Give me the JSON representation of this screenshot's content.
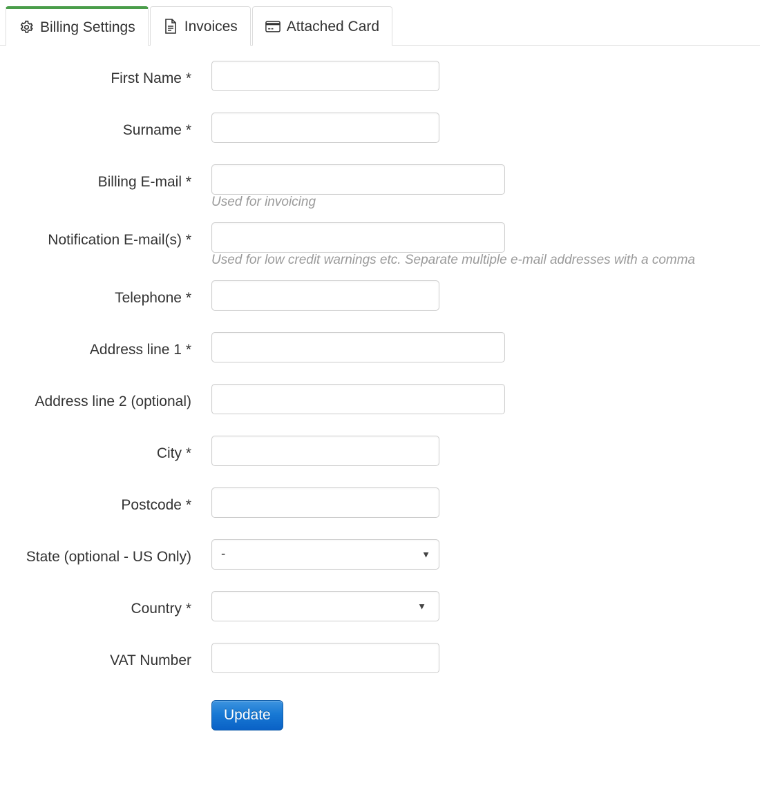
{
  "tabs": [
    {
      "label": "Billing Settings",
      "icon": "gear-icon",
      "active": true
    },
    {
      "label": "Invoices",
      "icon": "document-icon",
      "active": false
    },
    {
      "label": "Attached Card",
      "icon": "credit-card-icon",
      "active": false
    }
  ],
  "form": {
    "fields": [
      {
        "label": "First Name *",
        "type": "text",
        "value": "",
        "placeholder": "",
        "width": "short"
      },
      {
        "label": "Surname *",
        "type": "text",
        "value": "",
        "placeholder": "",
        "width": "short"
      },
      {
        "label": "Billing E-mail *",
        "type": "text",
        "value": "",
        "placeholder": "",
        "width": "wide",
        "help": "Used for invoicing"
      },
      {
        "label": "Notification E-mail(s) *",
        "type": "text",
        "value": "",
        "placeholder": "",
        "width": "wide",
        "help": "Used for low credit warnings etc. Separate multiple e-mail addresses with a comma"
      },
      {
        "label": "Telephone *",
        "type": "text",
        "value": "",
        "placeholder": "",
        "width": "short"
      },
      {
        "label": "Address line 1 *",
        "type": "text",
        "value": "",
        "placeholder": "",
        "width": "wide"
      },
      {
        "label": "Address line 2 (optional)",
        "type": "text",
        "value": "",
        "placeholder": "",
        "width": "wide"
      },
      {
        "label": "City *",
        "type": "text",
        "value": "",
        "placeholder": "",
        "width": "short"
      },
      {
        "label": "Postcode *",
        "type": "text",
        "value": "",
        "placeholder": "",
        "width": "short"
      },
      {
        "label": "State (optional - US Only)",
        "type": "select",
        "value": "-",
        "width": "short"
      },
      {
        "label": "Country *",
        "type": "select",
        "value": "",
        "width": "short"
      },
      {
        "label": "VAT Number",
        "type": "text",
        "value": "",
        "placeholder": "",
        "width": "short"
      }
    ],
    "submit_label": "Update"
  },
  "colors": {
    "active_tab_accent": "#4a9d4a",
    "border": "#dddddd",
    "input_border": "#cccccc",
    "help_text": "#9a9a9a",
    "button_top": "#3e94df",
    "button_bottom": "#0a62c6"
  },
  "icons": {
    "caret": "▼"
  }
}
